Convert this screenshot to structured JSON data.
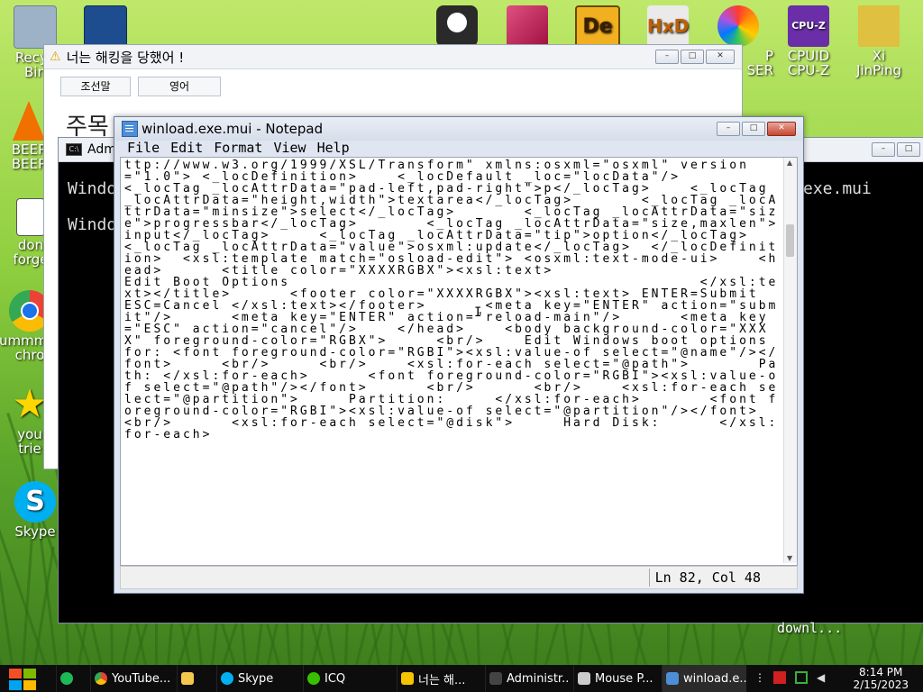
{
  "desktop_icons": [
    {
      "name": "recycle-bin",
      "label": "Recyc\nBin",
      "color": "#8aa0b4"
    },
    {
      "name": "virtualbox",
      "label": "",
      "color": "#1d4d8f"
    },
    {
      "name": "skull",
      "label": "",
      "color": "#222222"
    },
    {
      "name": "monitor-app",
      "label": "",
      "color": "#c02a5a"
    },
    {
      "name": "de-app",
      "label": "",
      "color": "#f0b020"
    },
    {
      "name": "hxd",
      "label": "",
      "color": "#e8e8e8"
    },
    {
      "name": "browser",
      "label": "P\nSER",
      "color": "#ff8a00"
    },
    {
      "name": "cpu-z",
      "label": "CPUID\nCPU-Z",
      "color": "#6a2ea8"
    },
    {
      "name": "xi-jinping",
      "label": "Xi\nJinPing",
      "color": "#e0c040"
    },
    {
      "name": "beep",
      "label": "BEEP\nBEEP",
      "color": "#f07000"
    },
    {
      "name": "dont-forget",
      "label": "don\nforge",
      "color": "#2a6cc0"
    },
    {
      "name": "chrome",
      "label": "ummmm\nchro",
      "color": "#1a73e8"
    },
    {
      "name": "star",
      "label": "you\ntrie",
      "color": "#ffd700"
    },
    {
      "name": "skype",
      "label": "Skype",
      "color": "#00aff0"
    }
  ],
  "korean_window": {
    "title": "너는 해킹을 당했어 !",
    "buttons": [
      "조선말",
      "영어"
    ],
    "heading": "주목"
  },
  "cmd_window": {
    "title": "Adm",
    "line1": "Windo",
    "line1_tail": "exe.mui",
    "line2": "Windo",
    "status": "downl..."
  },
  "notepad": {
    "title": "winload.exe.mui - Notepad",
    "menu": [
      "File",
      "Edit",
      "Format",
      "View",
      "Help"
    ],
    "content": "ttp://www.w3.org/1999/XSL/Transform\" xmlns:osxml=\"osxml\" version=\"1.0\"> <_locDefinition>    <_locDefault _loc=\"locData\"/>          <_locTag _locAttrData=\"pad-left,pad-right\">p</_locTag>    <_locTag _locAttrData=\"height,width\">textarea</_locTag>       <_locTag _locAttrData=\"minsize\">select</_locTag>       <_locTag _locAttrData=\"size\">progressbar</_locTag>       <_locTag _locAttrData=\"size,maxlen\">input</_locTag>     <_locTag _locAttrData=\"tip\">option</_locTag>     <_locTag _locAttrData=\"value\">osxml:update</_locTag>  </_locDefinition>  <xsl:template match=\"osload-edit\"> <osxml:text-mode-ui>    <head>      <title color=\"XXXXRGBX\"><xsl:text>                              Edit Boot Options                                          </xsl:text></title>      <footer color=\"XXXXRGBX\"><xsl:text> ENTER=Submit                                        ESC=Cancel </xsl:text></footer>      <meta key=\"ENTER\" action=\"submit\"/>      <meta key=\"ENTER\" action=\"reload-main\"/>      <meta key=\"ESC\" action=\"cancel\"/>    </head>    <body background-color=\"XXXX\" foreground-color=\"RGBX\">     <br/>    Edit Windows boot options for: <font foreground-color=\"RGBI\"><xsl:value-of select=\"@name\"/></font>     <br/>     <br/>    <xsl:for-each select=\"@path\">       Path: </xsl:for-each>      <font foreground-color=\"RGBI\"><xsl:value-of select=\"@path\"/></font>      <br/>      <br/>    <xsl:for-each select=\"@partition\">     Partition:     </xsl:for-each>       <font foreground-color=\"RGBI\"><xsl:value-of select=\"@partition\"/></font>      <br/>      <xsl:for-each select=\"@disk\">     Hard Disk:      </xsl:for-each>",
    "status": "Ln 82, Col 48"
  },
  "taskbar": {
    "items": [
      {
        "name": "taskbar-spotify",
        "label": "",
        "color": "#1db954"
      },
      {
        "name": "taskbar-youtube",
        "label": "YouTube...",
        "color": "#ea4335"
      },
      {
        "name": "taskbar-explorer",
        "label": "",
        "color": "#f2c94c"
      },
      {
        "name": "taskbar-skype",
        "label": "Skype",
        "color": "#00aff0"
      },
      {
        "name": "taskbar-icq",
        "label": "ICQ",
        "color": "#36c000"
      },
      {
        "name": "taskbar-hacked",
        "label": "너는 해...",
        "color": "#f5c400"
      },
      {
        "name": "taskbar-admin",
        "label": "Administr...",
        "color": "#444444"
      },
      {
        "name": "taskbar-mouse",
        "label": "Mouse P...",
        "color": "#cccccc"
      },
      {
        "name": "taskbar-winload",
        "label": "winload.e...",
        "color": "#4d8fd6"
      }
    ],
    "time": "8:14 PM",
    "date": "2/15/2023"
  }
}
